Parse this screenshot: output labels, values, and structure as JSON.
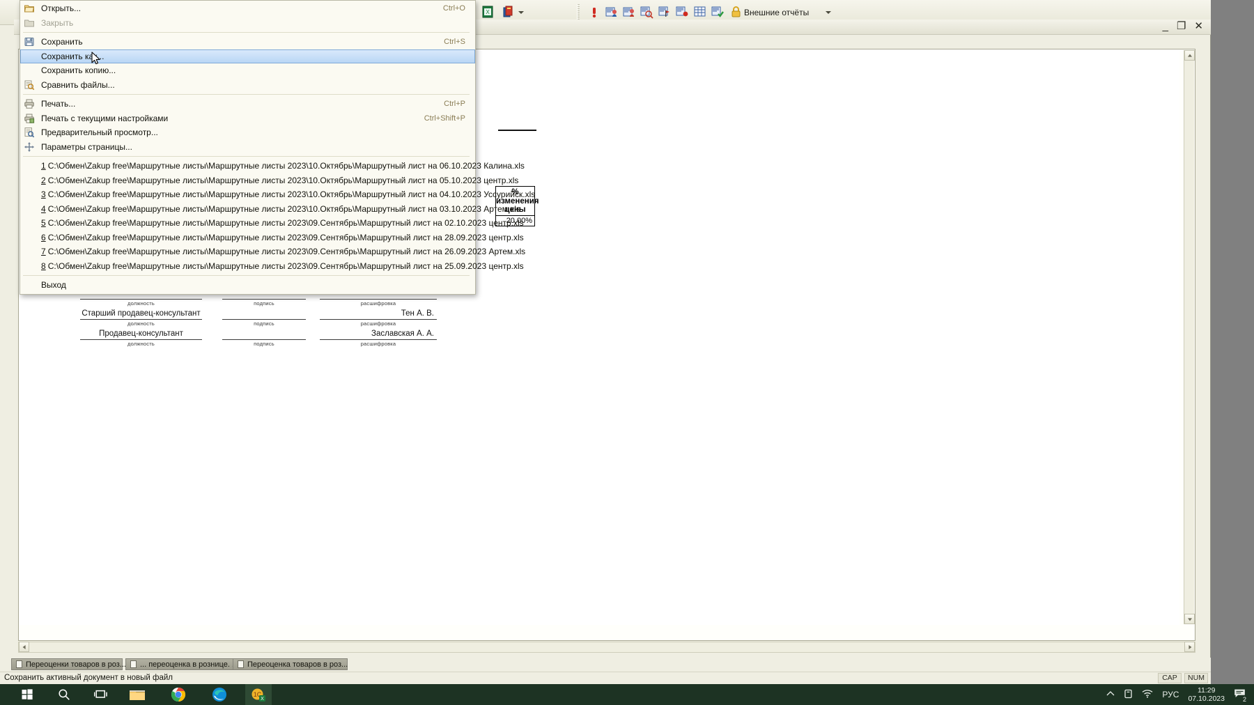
{
  "window": {
    "minimize_label": "_",
    "restore_label": "❐",
    "close_label": "✕"
  },
  "toolbar": {
    "external_reports_label": "Внешние отчёты",
    "icons": [
      "excel-green-icon",
      "report-stack-icon",
      "exclamation-red-icon",
      "user-card-blue-icon",
      "user-card-sum-icon",
      "user-card-magnify-icon",
      "sum-flag-red-icon",
      "sum-dot-red-icon",
      "table-sum-icon",
      "sum-check-green-icon",
      "lock-yellow-icon"
    ]
  },
  "menu": {
    "name": "file-menu",
    "items": [
      {
        "label": "Открыть...",
        "accel": "Ctrl+O",
        "icon": "folder-open-icon",
        "underline_index": 1,
        "state": "normal"
      },
      {
        "label": "Закрыть",
        "accel": "",
        "icon": "folder-closed-icon",
        "underline_index": 1,
        "state": "disabled"
      },
      {
        "separator": true
      },
      {
        "label": "Сохранить",
        "accel": "Ctrl+S",
        "icon": "floppy-save-icon",
        "underline_index": 1,
        "state": "normal"
      },
      {
        "label": "Сохранить как...",
        "accel": "",
        "icon": "none",
        "underline_index": 11,
        "state": "selected"
      },
      {
        "label": "Сохранить копию...",
        "accel": "",
        "icon": "none",
        "underline_index": 17,
        "state": "normal"
      },
      {
        "label": "Сравнить файлы...",
        "accel": "",
        "icon": "compare-files-icon",
        "underline_index": 9,
        "state": "normal"
      },
      {
        "separator": true
      },
      {
        "label": "Печать...",
        "accel": "Ctrl+P",
        "icon": "printer-icon",
        "underline_index": 1,
        "state": "normal"
      },
      {
        "label": "Печать с текущими настройками",
        "accel": "Ctrl+Shift+P",
        "icon": "printer-settings-icon",
        "underline_index": 3,
        "state": "normal"
      },
      {
        "label": "Предварительный просмотр...",
        "accel": "",
        "icon": "print-preview-icon",
        "underline_index": 2,
        "state": "normal"
      },
      {
        "label": "Параметры страницы...",
        "accel": "",
        "icon": "page-setup-icon",
        "underline_index": 5,
        "state": "normal"
      },
      {
        "separator": true
      }
    ],
    "recent_files": [
      {
        "num": "1",
        "path": "C:\\Обмен\\Zakup free\\Маршрутные листы\\Маршрутные листы 2023\\10.Октябрь\\Маршрутный лист на 06.10.2023 Калина.xls"
      },
      {
        "num": "2",
        "path": "C:\\Обмен\\Zakup free\\Маршрутные листы\\Маршрутные листы 2023\\10.Октябрь\\Маршрутный лист на 05.10.2023 центр.xls"
      },
      {
        "num": "3",
        "path": "C:\\Обмен\\Zakup free\\Маршрутные листы\\Маршрутные листы 2023\\10.Октябрь\\Маршрутный лист на 04.10.2023 Уссурийск.xls"
      },
      {
        "num": "4",
        "path": "C:\\Обмен\\Zakup free\\Маршрутные листы\\Маршрутные листы 2023\\10.Октябрь\\Маршрутный лист на 03.10.2023 Артем.xls"
      },
      {
        "num": "5",
        "path": "C:\\Обмен\\Zakup free\\Маршрутные листы\\Маршрутные листы 2023\\09.Сентябрь\\Маршрутный лист на 02.10.2023 центр.xls"
      },
      {
        "num": "6",
        "path": "C:\\Обмен\\Zakup free\\Маршрутные листы\\Маршрутные листы 2023\\09.Сентябрь\\Маршрутный лист на 28.09.2023 центр.xls"
      },
      {
        "num": "7",
        "path": "C:\\Обмен\\Zakup free\\Маршрутные листы\\Маршрутные листы 2023\\09.Сентябрь\\Маршрутный лист на 26.09.2023 Артем.xls"
      },
      {
        "num": "8",
        "path": "C:\\Обмен\\Zakup free\\Маршрутные листы\\Маршрутные листы 2023\\09.Сентябрь\\Маршрутный лист на 25.09.2023 центр.xls"
      }
    ],
    "exit": {
      "label": "Выход",
      "underline_index": 1
    }
  },
  "document": {
    "price_table": {
      "header_line1": "%",
      "header_line2": "изменения",
      "header_line3": "цены",
      "value": "20,00%"
    },
    "signatures": {
      "captions": {
        "position": "должность",
        "signature": "подпись",
        "decoding": "расшифровка"
      },
      "rows": [
        {
          "position": "",
          "name": ""
        },
        {
          "position": "Старший продавец-консультант",
          "name": "Тен А. В."
        },
        {
          "position": "Продавец-консультант",
          "name": "Заславская А. А."
        }
      ]
    }
  },
  "window_tabs": [
    {
      "label": "Переоценки товаров в роз...",
      "active": false
    },
    {
      "label": "... переоценка в рознице. ...",
      "active": false
    },
    {
      "label": "Переоценка товаров в роз...",
      "active": true
    }
  ],
  "status": {
    "hint": "Сохранить активный документ в новый файл",
    "caps": "CAP",
    "num": "NUM"
  },
  "taskbar": {
    "system_icons": [
      "windows-start-icon",
      "search-icon",
      "task-view-icon",
      "file-explorer-icon",
      "chrome-icon",
      "edge-icon",
      "1c-excel-icon"
    ],
    "tray": {
      "chevron_up": "chevron-up-icon",
      "device_icon": "device-icon",
      "network_icon": "wifi-icon",
      "language": "РУС",
      "time": "11:29",
      "date": "07.10.2023",
      "notifications_count": "2"
    }
  },
  "colors": {
    "menu_bg": "#fbfaf2",
    "menu_selected": "#b9d6f5",
    "app_bg": "#efeee2",
    "accel_text": "#8a7d55",
    "taskbar_bg": "#1d3323",
    "desktop": "#808080"
  }
}
